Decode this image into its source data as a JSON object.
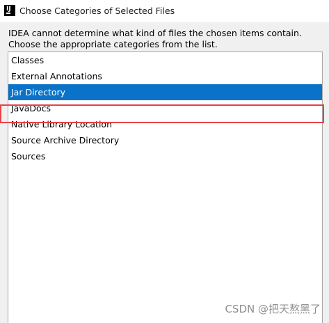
{
  "window": {
    "title": "Choose Categories of Selected Files",
    "icon": "intellij-idea-icon"
  },
  "description": {
    "line1": "IDEA cannot determine what kind of files the chosen items contain.",
    "line2": "Choose the appropriate categories from the list."
  },
  "list": {
    "items": [
      {
        "label": "Classes",
        "selected": false
      },
      {
        "label": "External Annotations",
        "selected": false
      },
      {
        "label": "Jar Directory",
        "selected": true
      },
      {
        "label": "JavaDocs",
        "selected": false
      },
      {
        "label": "Native Library Location",
        "selected": false
      },
      {
        "label": "Source Archive Directory",
        "selected": false
      },
      {
        "label": "Sources",
        "selected": false
      }
    ]
  },
  "watermark": {
    "text": "CSDN @把天熬黑了"
  },
  "colors": {
    "selection": "#0b73c7",
    "annotation_border": "#e8414a",
    "dialog_bg": "#f0f0f0"
  }
}
